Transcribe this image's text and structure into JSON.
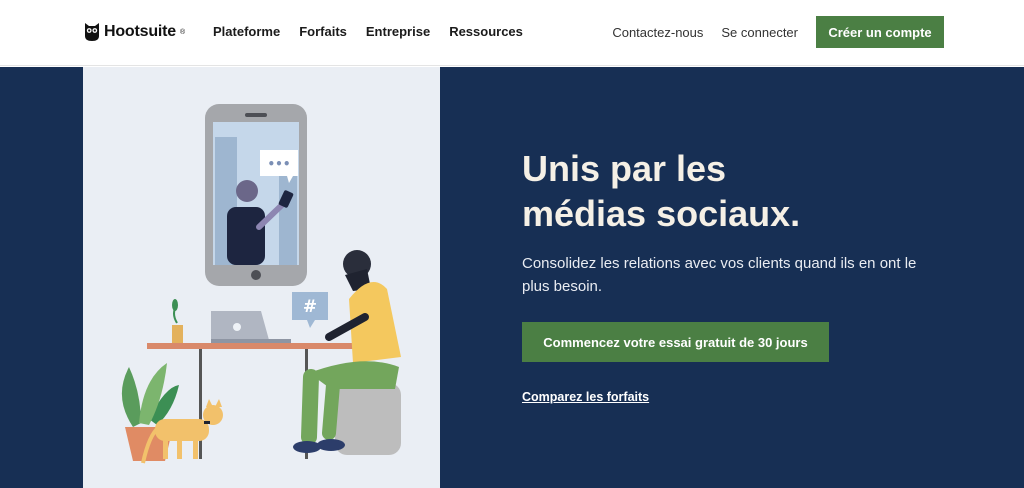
{
  "brand": {
    "name": "Hootsuite",
    "reg": "®"
  },
  "nav": [
    "Plateforme",
    "Forfaits",
    "Entreprise",
    "Ressources"
  ],
  "header_links": {
    "contact": "Contactez-nous",
    "login": "Se connecter",
    "signup": "Créer un compte"
  },
  "hero": {
    "title_line1": "Unis par les",
    "title_line2": "médias sociaux.",
    "subtitle": "Consolidez les relations avec vos clients quand ils en ont le plus besoin.",
    "cta": "Commencez votre essai gratuit de 30 jours",
    "compare": "Comparez les forfaits"
  },
  "illustration": {
    "hashtag": "#",
    "typing": "•••"
  },
  "colors": {
    "navy": "#172f54",
    "green": "#4b7f44",
    "panel": "#eaeef4",
    "headline": "#f5f0e6"
  }
}
